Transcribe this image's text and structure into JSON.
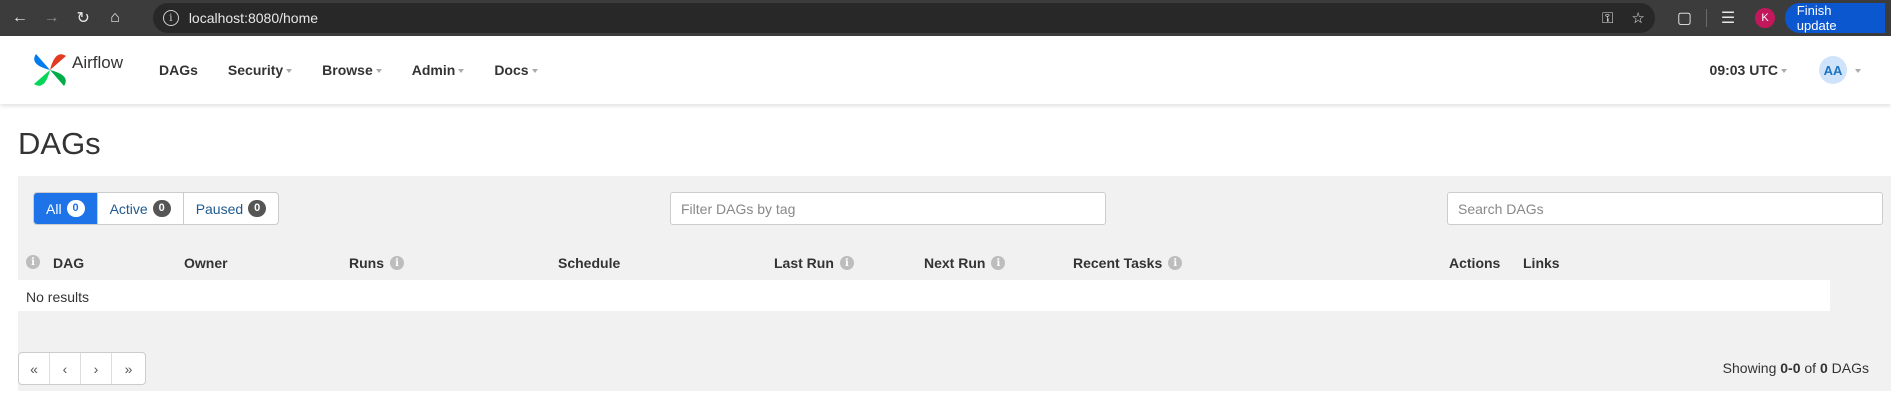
{
  "browser": {
    "url": "localhost:8080/home",
    "profile_initial": "K",
    "finish_update_label": "Finish update"
  },
  "navbar": {
    "brand": "Airflow",
    "items": [
      {
        "label": "DAGs",
        "dropdown": false
      },
      {
        "label": "Security",
        "dropdown": true
      },
      {
        "label": "Browse",
        "dropdown": true
      },
      {
        "label": "Admin",
        "dropdown": true
      },
      {
        "label": "Docs",
        "dropdown": true
      }
    ],
    "clock": "09:03 UTC",
    "user_initials": "AA"
  },
  "page": {
    "title": "DAGs"
  },
  "filters": {
    "tabs": [
      {
        "label": "All",
        "count": "0",
        "active": true
      },
      {
        "label": "Active",
        "count": "0",
        "active": false
      },
      {
        "label": "Paused",
        "count": "0",
        "active": false
      }
    ],
    "tag_placeholder": "Filter DAGs by tag",
    "search_placeholder": "Search DAGs"
  },
  "table": {
    "columns": {
      "dag": "DAG",
      "owner": "Owner",
      "runs": "Runs",
      "schedule": "Schedule",
      "last_run": "Last Run",
      "next_run": "Next Run",
      "recent_tasks": "Recent Tasks",
      "actions": "Actions",
      "links": "Links"
    },
    "empty_text": "No results"
  },
  "pagination": {
    "first": "«",
    "prev": "‹",
    "next": "›",
    "last": "»",
    "showing_prefix": "Showing ",
    "range": "0-0",
    "of": " of ",
    "total": "0",
    "suffix": " DAGs"
  },
  "colors": {
    "accent": "#1e73e8",
    "panel_bg": "#f1f1f1",
    "chrome_bg": "#3c3c3c"
  }
}
